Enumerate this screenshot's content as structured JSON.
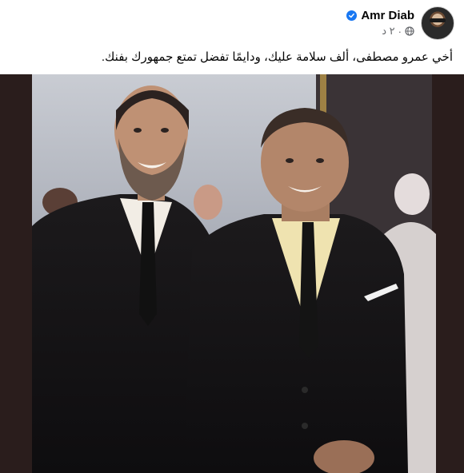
{
  "post": {
    "author": {
      "name": "Amr Diab",
      "verified": true,
      "avatar_icon": "avatar"
    },
    "meta": {
      "time": "٢ د",
      "separator": "·",
      "privacy_icon": "globe-icon"
    },
    "caption": "أخي عمرو مصطفى، ألف سلامة عليك، ودايمًا تفضل تمتع جمهورك بفنك.",
    "colors": {
      "verified": "#1877f2",
      "meta_text": "#65676b",
      "photo_border": "#2a1d1c"
    }
  }
}
